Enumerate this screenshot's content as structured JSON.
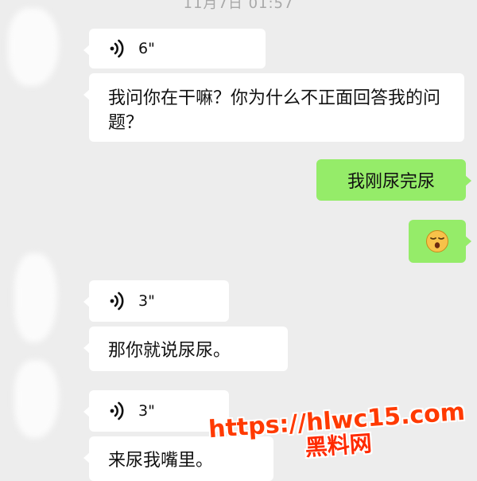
{
  "timestamp": "11月7日 01:57",
  "messages": [
    {
      "side": "left",
      "kind": "voice",
      "duration": "6\""
    },
    {
      "side": "left",
      "kind": "text",
      "text": "我问你在干嘛？你为什么不正面回答我的问题？"
    },
    {
      "side": "right",
      "kind": "text",
      "text": "我刚尿完尿"
    },
    {
      "side": "right",
      "kind": "emoji",
      "emoji": "sleepy-face"
    },
    {
      "side": "left",
      "kind": "voice",
      "duration": "3\""
    },
    {
      "side": "left",
      "kind": "text",
      "text": "那你就说尿尿。"
    },
    {
      "side": "left",
      "kind": "voice",
      "duration": "3\""
    },
    {
      "side": "left",
      "kind": "text",
      "text": "来尿我嘴里。"
    }
  ],
  "watermark": {
    "url": "https://hlwc15.com",
    "name": "黑料网"
  },
  "colors": {
    "background": "#ededed",
    "incoming_bubble": "#ffffff",
    "outgoing_bubble": "#95ec69",
    "watermark": "#ff3a00"
  }
}
